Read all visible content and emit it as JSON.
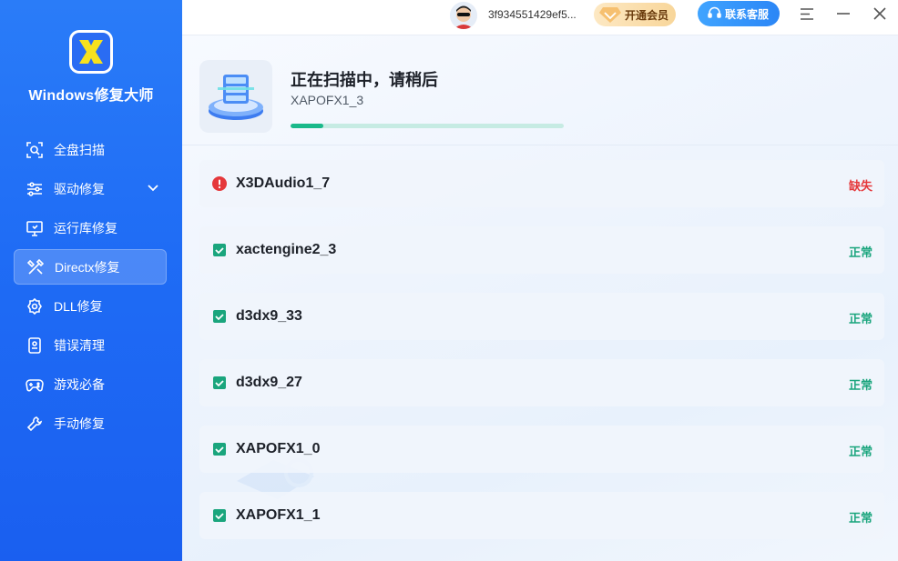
{
  "app": {
    "title": "Windows修复大师"
  },
  "sidebar": {
    "items": [
      {
        "label": "全盘扫描",
        "icon": "scan-icon",
        "active": false
      },
      {
        "label": "驱动修复",
        "icon": "sliders-icon",
        "active": false,
        "expandable": true
      },
      {
        "label": "运行库修复",
        "icon": "monitor-icon",
        "active": false
      },
      {
        "label": "Directx修复",
        "icon": "tools-icon",
        "active": true
      },
      {
        "label": "DLL修复",
        "icon": "gear-icon",
        "active": false
      },
      {
        "label": "错误清理",
        "icon": "phone-clean-icon",
        "active": false
      },
      {
        "label": "游戏必备",
        "icon": "gamepad-icon",
        "active": false
      },
      {
        "label": "手动修复",
        "icon": "wrench-icon",
        "active": false
      }
    ]
  },
  "topbar": {
    "user_id": "3f934551429ef5...",
    "vip_label": "开通会员",
    "support_label": "联系客服"
  },
  "scan": {
    "title": "正在扫描中，请稍后",
    "current_item": "XAPOFX1_3",
    "progress": 0.12
  },
  "results": [
    {
      "name": "X3DAudio1_7",
      "status": "缺失",
      "state": "missing"
    },
    {
      "name": "xactengine2_3",
      "status": "正常",
      "state": "ok"
    },
    {
      "name": "d3dx9_33",
      "status": "正常",
      "state": "ok"
    },
    {
      "name": "d3dx9_27",
      "status": "正常",
      "state": "ok"
    },
    {
      "name": "XAPOFX1_0",
      "status": "正常",
      "state": "ok"
    },
    {
      "name": "XAPOFX1_1",
      "status": "正常",
      "state": "ok"
    }
  ],
  "colors": {
    "accent": "#1f6cf5",
    "ok": "#1aa57d",
    "missing": "#e5383b",
    "progress": "#19b98a"
  }
}
